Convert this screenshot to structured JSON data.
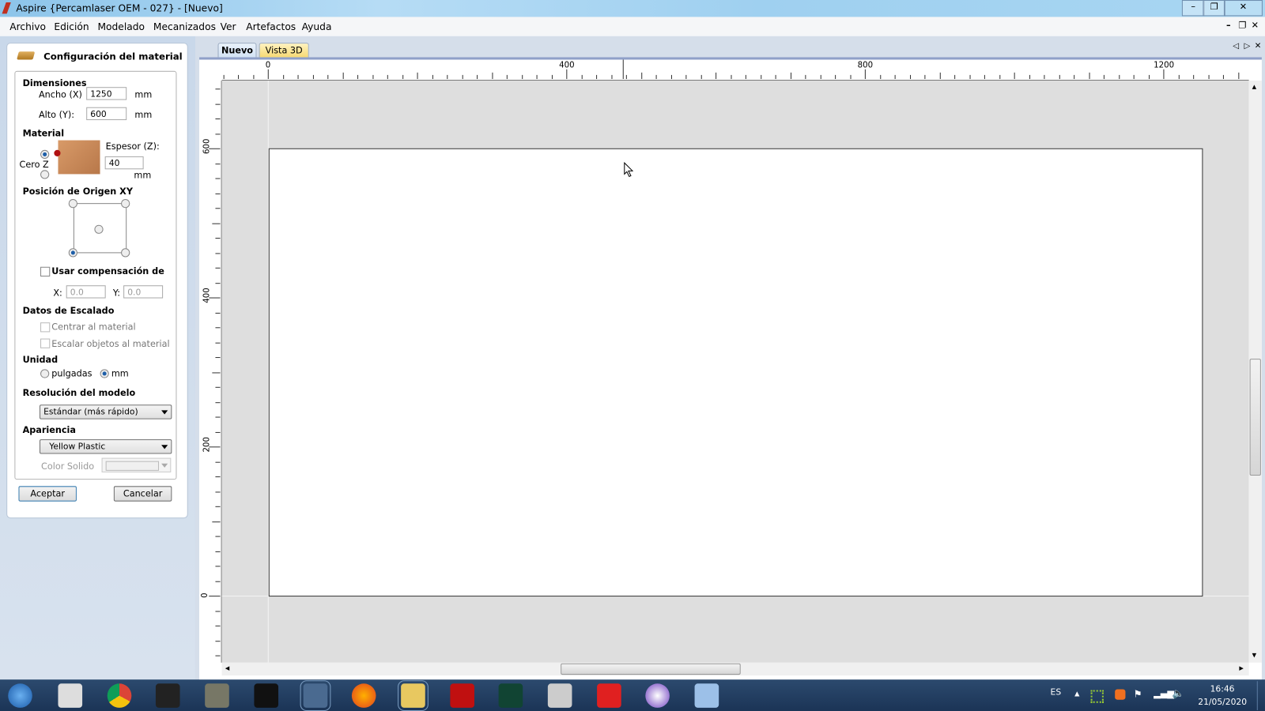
{
  "window": {
    "title": "Aspire {Percamlaser OEM - 027} - [Nuevo]",
    "minimize": "–",
    "restore": "❐",
    "close": "✕"
  },
  "menu": [
    "Archivo",
    "Edición",
    "Modelado",
    "Mecanizados",
    "Ver",
    "Artefactos",
    "Ayuda"
  ],
  "mdi_controls": {
    "minimize": "–",
    "restore": "❐",
    "close": "✕"
  },
  "panel": {
    "title": "Configuración del material",
    "dimensions": {
      "heading": "Dimensiones",
      "width_label": "Ancho (X)",
      "width_value": "1250",
      "height_label": "Alto (Y):",
      "height_value": "600",
      "unit": "mm"
    },
    "material": {
      "heading": "Material",
      "zero_label": "Cero Z",
      "zero_selected": "top",
      "thickness_label": "Espesor (Z):",
      "thickness_value": "40",
      "unit": "mm"
    },
    "origin": {
      "heading": "Posición de Origen XY",
      "selected": "bottom-left"
    },
    "offset": {
      "checkbox_label": "Usar compensación de or",
      "checked": false,
      "x_label": "X:",
      "x_value": "0.0",
      "y_label": "Y:",
      "y_value": "0.0"
    },
    "scaling": {
      "heading": "Datos de Escalado",
      "center_label": "Centrar al material",
      "scale_label": "Escalar objetos al material"
    },
    "units": {
      "heading": "Unidad",
      "inches_label": "pulgadas",
      "mm_label": "mm",
      "selected": "mm"
    },
    "resolution": {
      "heading": "Resolución del modelo",
      "value": "Estándar (más rápido)"
    },
    "appearance": {
      "heading": "Apariencia",
      "value": "Yellow Plastic",
      "solid_color_label": "Color Solido"
    },
    "accept": "Aceptar",
    "cancel": "Cancelar"
  },
  "tabs": [
    {
      "label": "Nuevo",
      "active": true
    },
    {
      "label": "Vista 3D",
      "active": false
    }
  ],
  "rulers": {
    "top_labels": [
      "0",
      "400",
      "800",
      "1200"
    ],
    "left_labels": [
      "600",
      "400",
      "200",
      "0"
    ]
  },
  "taskbar": {
    "icons": [
      "start-orb",
      "printer",
      "chrome",
      "inkscape",
      "gimp",
      "app-x",
      "aspire",
      "firefox",
      "file-explorer",
      "acrobat",
      "app-green",
      "snipping-tool",
      "app-red-m",
      "app-purple",
      "calculator"
    ],
    "lang": "ES",
    "time": "16:46",
    "date": "21/05/2020"
  }
}
